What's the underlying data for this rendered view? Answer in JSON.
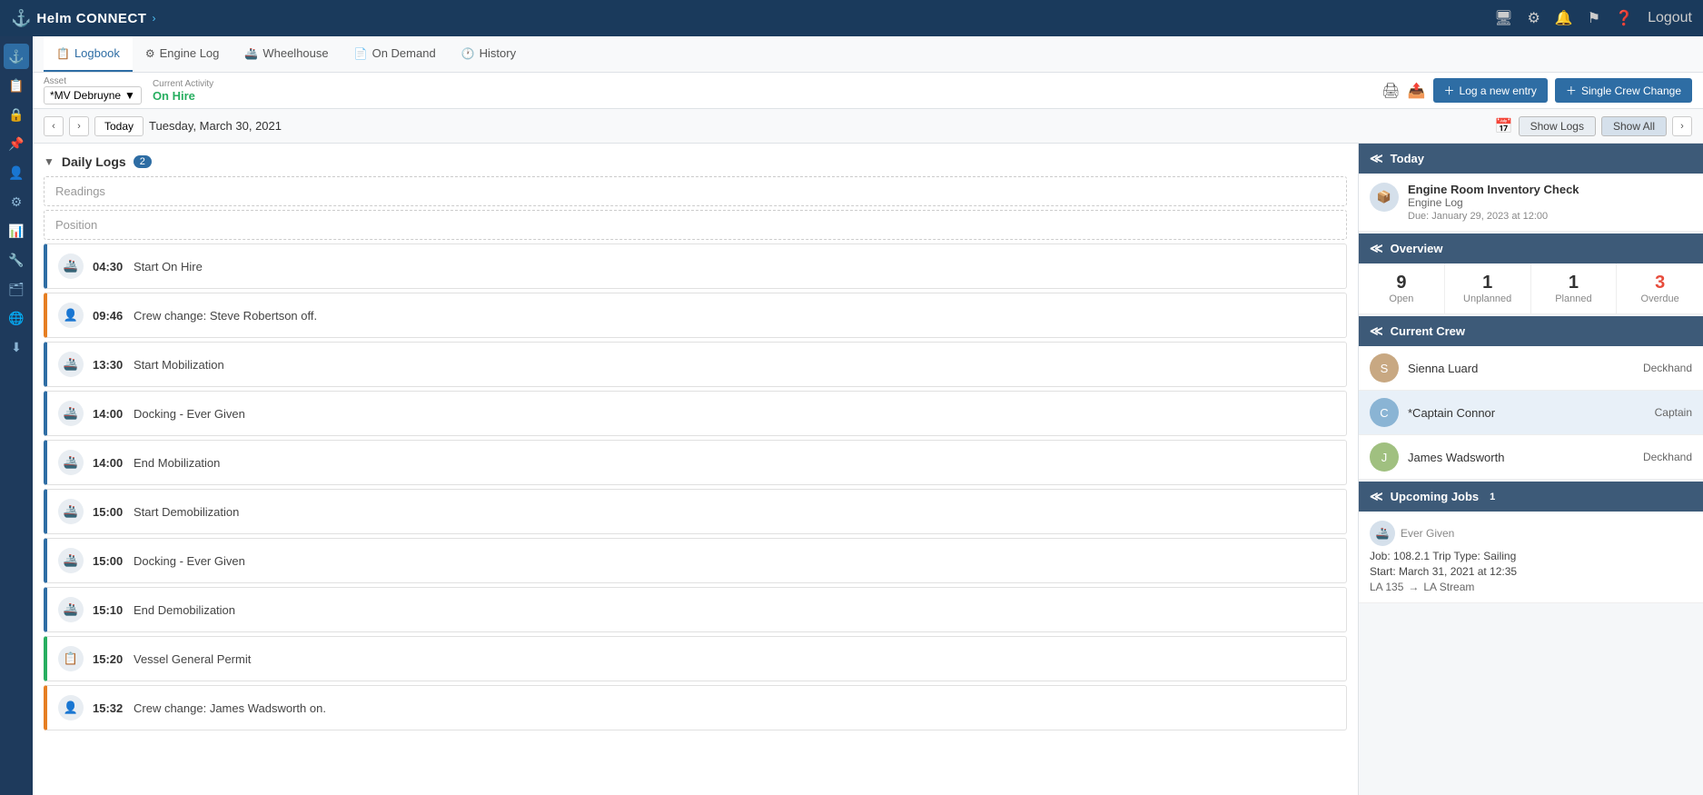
{
  "app": {
    "name": "Helm CONNECT",
    "logo_icon": "⚓",
    "arrow": "›"
  },
  "topnav": {
    "monitor_icon": "⊞",
    "gear_icon": "⚙",
    "bell_icon": "🔔",
    "flag_icon": "⚑",
    "help_icon": "?",
    "logout_label": "Logout"
  },
  "sidebar": {
    "items": [
      {
        "icon": "⚓",
        "label": "home"
      },
      {
        "icon": "📋",
        "label": "tasks"
      },
      {
        "icon": "🔒",
        "label": "lock"
      },
      {
        "icon": "📌",
        "label": "pin"
      },
      {
        "icon": "👤",
        "label": "user"
      },
      {
        "icon": "⚙",
        "label": "settings"
      },
      {
        "icon": "📊",
        "label": "reports"
      },
      {
        "icon": "🔧",
        "label": "maintenance"
      },
      {
        "icon": "🗂",
        "label": "files"
      },
      {
        "icon": "🌐",
        "label": "globe"
      },
      {
        "icon": "⬇",
        "label": "download"
      }
    ]
  },
  "tabs": [
    {
      "label": "Logbook",
      "icon": "📋",
      "active": true
    },
    {
      "label": "Engine Log",
      "icon": "⚙",
      "active": false
    },
    {
      "label": "Wheelhouse",
      "icon": "🚢",
      "active": false
    },
    {
      "label": "On Demand",
      "icon": "📄",
      "active": false
    },
    {
      "label": "History",
      "icon": "🕐",
      "active": false
    }
  ],
  "toolbar": {
    "asset_label": "Asset",
    "asset_value": "*MV Debruyne",
    "activity_label": "Current Activity",
    "status": "On Hire",
    "print_icon": "🖨",
    "export_icon": "📤",
    "log_entry_btn": "Log a new entry",
    "crew_change_btn": "Single Crew Change"
  },
  "date_nav": {
    "today_btn": "Today",
    "date": "Tuesday, March 30, 2021",
    "show_logs_btn": "Show Logs",
    "show_all_btn": "Show All"
  },
  "daily_logs": {
    "title": "Daily Logs",
    "count": "2",
    "readings_placeholder": "Readings",
    "position_placeholder": "Position"
  },
  "log_entries": [
    {
      "time": "04:30",
      "desc": "Start On Hire",
      "color": "blue",
      "icon": "🚢"
    },
    {
      "time": "09:46",
      "desc": "Crew change: Steve Robertson off.",
      "color": "orange",
      "icon": "👤"
    },
    {
      "time": "13:30",
      "desc": "Start Mobilization",
      "color": "blue",
      "icon": "🚢"
    },
    {
      "time": "14:00",
      "desc": "Docking - Ever Given",
      "color": "blue",
      "icon": "🚢"
    },
    {
      "time": "14:00",
      "desc": "End Mobilization",
      "color": "blue",
      "icon": "🚢"
    },
    {
      "time": "15:00",
      "desc": "Start Demobilization",
      "color": "blue",
      "icon": "🚢"
    },
    {
      "time": "15:00",
      "desc": "Docking - Ever Given",
      "color": "blue",
      "icon": "🚢"
    },
    {
      "time": "15:10",
      "desc": "End Demobilization",
      "color": "blue",
      "icon": "🚢"
    },
    {
      "time": "15:20",
      "desc": "Vessel General Permit",
      "color": "green",
      "icon": "📋"
    },
    {
      "time": "15:32",
      "desc": "Crew change: James Wadsworth on.",
      "color": "orange",
      "icon": "👤"
    }
  ],
  "right_panel": {
    "today_section": {
      "title": "Today",
      "item": {
        "title": "Engine Room Inventory Check",
        "subtitle": "Engine Log",
        "due": "Due: January 29, 2023 at 12:00"
      }
    },
    "overview_section": {
      "title": "Overview",
      "open": {
        "num": "9",
        "label": "Open"
      },
      "unplanned": {
        "num": "1",
        "label": "Unplanned"
      },
      "planned": {
        "num": "1",
        "label": "Planned"
      },
      "overdue": {
        "num": "3",
        "label": "Overdue"
      }
    },
    "crew_section": {
      "title": "Current Crew",
      "members": [
        {
          "name": "Sienna Luard",
          "role": "Deckhand",
          "highlighted": false
        },
        {
          "name": "*Captain Connor",
          "role": "Captain",
          "highlighted": true
        },
        {
          "name": "James Wadsworth",
          "role": "Deckhand",
          "highlighted": false
        }
      ]
    },
    "upcoming_section": {
      "title": "Upcoming Jobs",
      "count": "1",
      "item": {
        "vessel": "Ever Given",
        "job": "108.2.1",
        "trip_type": "Sailing",
        "start": "March 31, 2021 at 12:35",
        "route_from": "LA 135",
        "route_to": "LA Stream"
      }
    }
  }
}
